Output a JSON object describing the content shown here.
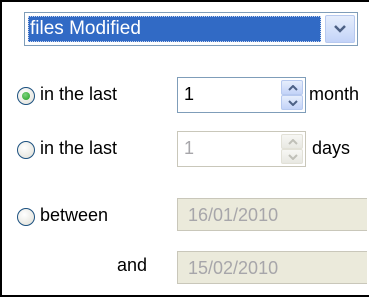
{
  "combo": {
    "selected": "files Modified",
    "arrow_icon": "chevron-down-icon"
  },
  "rows": {
    "last_months": {
      "label": "in the last",
      "value": "1",
      "unit": "month",
      "checked": true
    },
    "last_days": {
      "label": "in the last",
      "value": "1",
      "unit": "days",
      "checked": false
    },
    "between": {
      "label": "between",
      "date_from": "16/01/2010",
      "checked": false
    },
    "and": {
      "label": "and",
      "date_to": "15/02/2010"
    }
  },
  "colors": {
    "selection": "#316ac5",
    "radio_dot": "#21a121",
    "disabled_bg": "#ebeadb"
  }
}
